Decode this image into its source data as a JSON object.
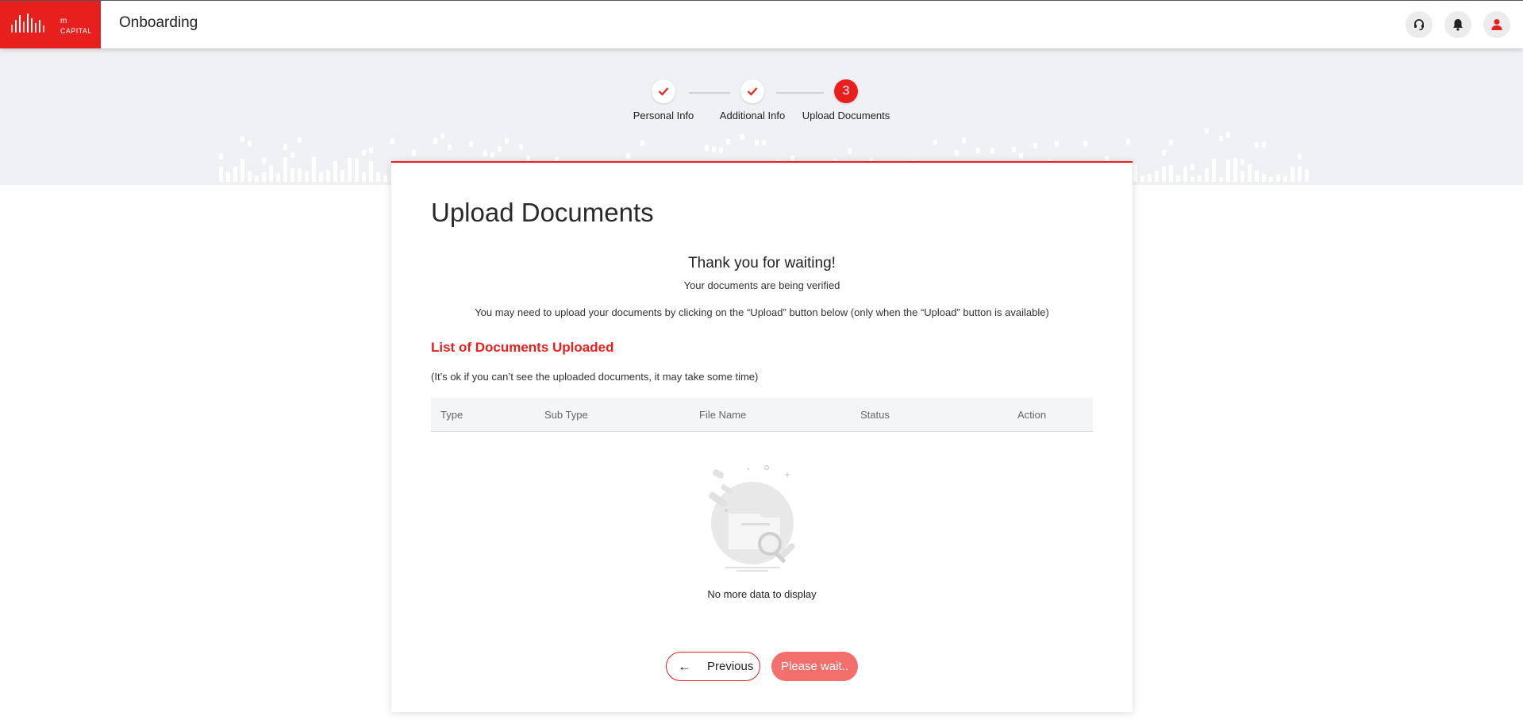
{
  "header": {
    "logo_text_m": "m",
    "logo_text_capital": "CAPITAL",
    "title": "Onboarding",
    "icons": [
      "support-icon",
      "bell-icon",
      "user-icon"
    ]
  },
  "stepper": {
    "steps": [
      {
        "label": "Personal Info",
        "state": "done"
      },
      {
        "label": "Additional Info",
        "state": "done"
      },
      {
        "label": "Upload Documents",
        "state": "active",
        "number": "3"
      }
    ]
  },
  "card": {
    "title": "Upload Documents",
    "thanks": "Thank you for waiting!",
    "verifying": "Your documents are being verified",
    "upload_note": "You may need to upload your documents by clicking on the “Upload” button below (only when the “Upload” button is available)",
    "list_title": "List of Documents Uploaded",
    "ok_note": "(It’s ok if you can’t see the uploaded documents, it may take some time)",
    "table": {
      "columns": [
        "Type",
        "Sub Type",
        "File Name",
        "Status",
        "Action"
      ],
      "rows": []
    },
    "empty_text": "No more data to display",
    "prev_label": "Previous",
    "wait_label": "Please wait.."
  },
  "colors": {
    "brand": "#e8201d",
    "button_disabled": "#f26f6c",
    "band_bg": "#f0f1f4"
  }
}
